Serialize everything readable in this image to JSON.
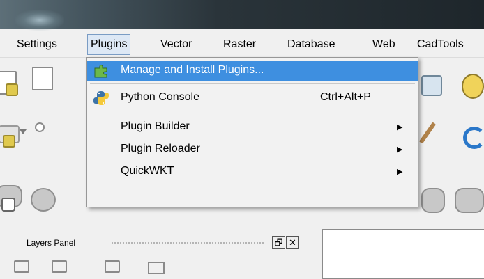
{
  "menubar": {
    "items": [
      {
        "label": "Settings"
      },
      {
        "label": "Plugins"
      },
      {
        "label": "Vector"
      },
      {
        "label": "Raster"
      },
      {
        "label": "Database"
      },
      {
        "label": "Web"
      },
      {
        "label": "CadTools"
      }
    ]
  },
  "plugins_menu": {
    "items": [
      {
        "label": "Manage and Install Plugins...",
        "icon": "plugin-puzzle-icon",
        "highlighted": true
      },
      {
        "label": "Python Console",
        "shortcut": "Ctrl+Alt+P",
        "icon": "python-icon"
      },
      {
        "label": "Plugin Builder",
        "submenu": true
      },
      {
        "label": "Plugin Reloader",
        "submenu": true
      },
      {
        "label": "QuickWKT",
        "submenu": true
      }
    ]
  },
  "layers_panel": {
    "title": "Layers Panel",
    "float_button": "🗗",
    "close_button": "✕"
  },
  "colors": {
    "highlight": "#3e8fe0",
    "menu_background": "#f2f2f2"
  }
}
